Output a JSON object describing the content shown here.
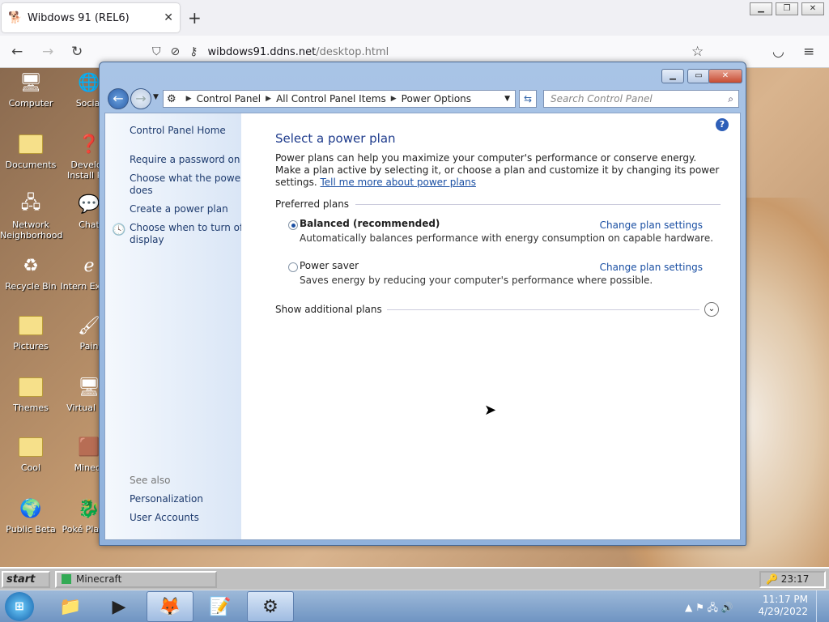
{
  "browser": {
    "tab_title": "Wibdows 91 (REL6)",
    "url_host": "wibdows91.ddns.net",
    "url_path": "/desktop.html"
  },
  "desktop_icons": [
    {
      "label": "Computer"
    },
    {
      "label": "Social"
    },
    {
      "label": "Documents"
    },
    {
      "label": "Develop Install Pro"
    },
    {
      "label": "Network Neighborhood"
    },
    {
      "label": "Chat"
    },
    {
      "label": "Recycle Bin"
    },
    {
      "label": "Intern Explor"
    },
    {
      "label": "Pictures"
    },
    {
      "label": "Pain"
    },
    {
      "label": "Themes"
    },
    {
      "label": "Virtual Ma"
    },
    {
      "label": "Cool"
    },
    {
      "label": "Minecr"
    },
    {
      "label": "Public Beta"
    },
    {
      "label": "Poké Platinu"
    }
  ],
  "window": {
    "breadcrumb": [
      "Control Panel",
      "All Control Panel Items",
      "Power Options"
    ],
    "search_placeholder": "Search Control Panel",
    "left_links": [
      "Control Panel Home",
      "Require a password on wa",
      "Choose what the power bu",
      "does",
      "Create a power plan",
      "Choose when to turn off th",
      "display"
    ],
    "see_also": {
      "heading": "See also",
      "links": [
        "Personalization",
        "User Accounts"
      ]
    },
    "title": "Select a power plan",
    "description": "Power plans can help you maximize your computer's performance or conserve energy. Make a plan active by selecting it, or choose a plan and customize it by changing its power settings.",
    "tell_me_more": "Tell me more about power plans",
    "preferred_heading": "Preferred plans",
    "plans": [
      {
        "name": "Balanced (recommended)",
        "selected": true,
        "desc": "Automatically balances performance with energy consumption on capable hardware.",
        "link": "Change plan settings"
      },
      {
        "name": "Power saver",
        "selected": false,
        "desc": "Saves energy by reducing your computer's performance where possible.",
        "link": "Change plan settings"
      }
    ],
    "show_more": "Show additional plans"
  },
  "taskbar95": {
    "start": "start",
    "task": "Minecraft",
    "time": "23:17"
  },
  "taskbar7": {
    "time": "11:17 PM",
    "date": "4/29/2022"
  }
}
